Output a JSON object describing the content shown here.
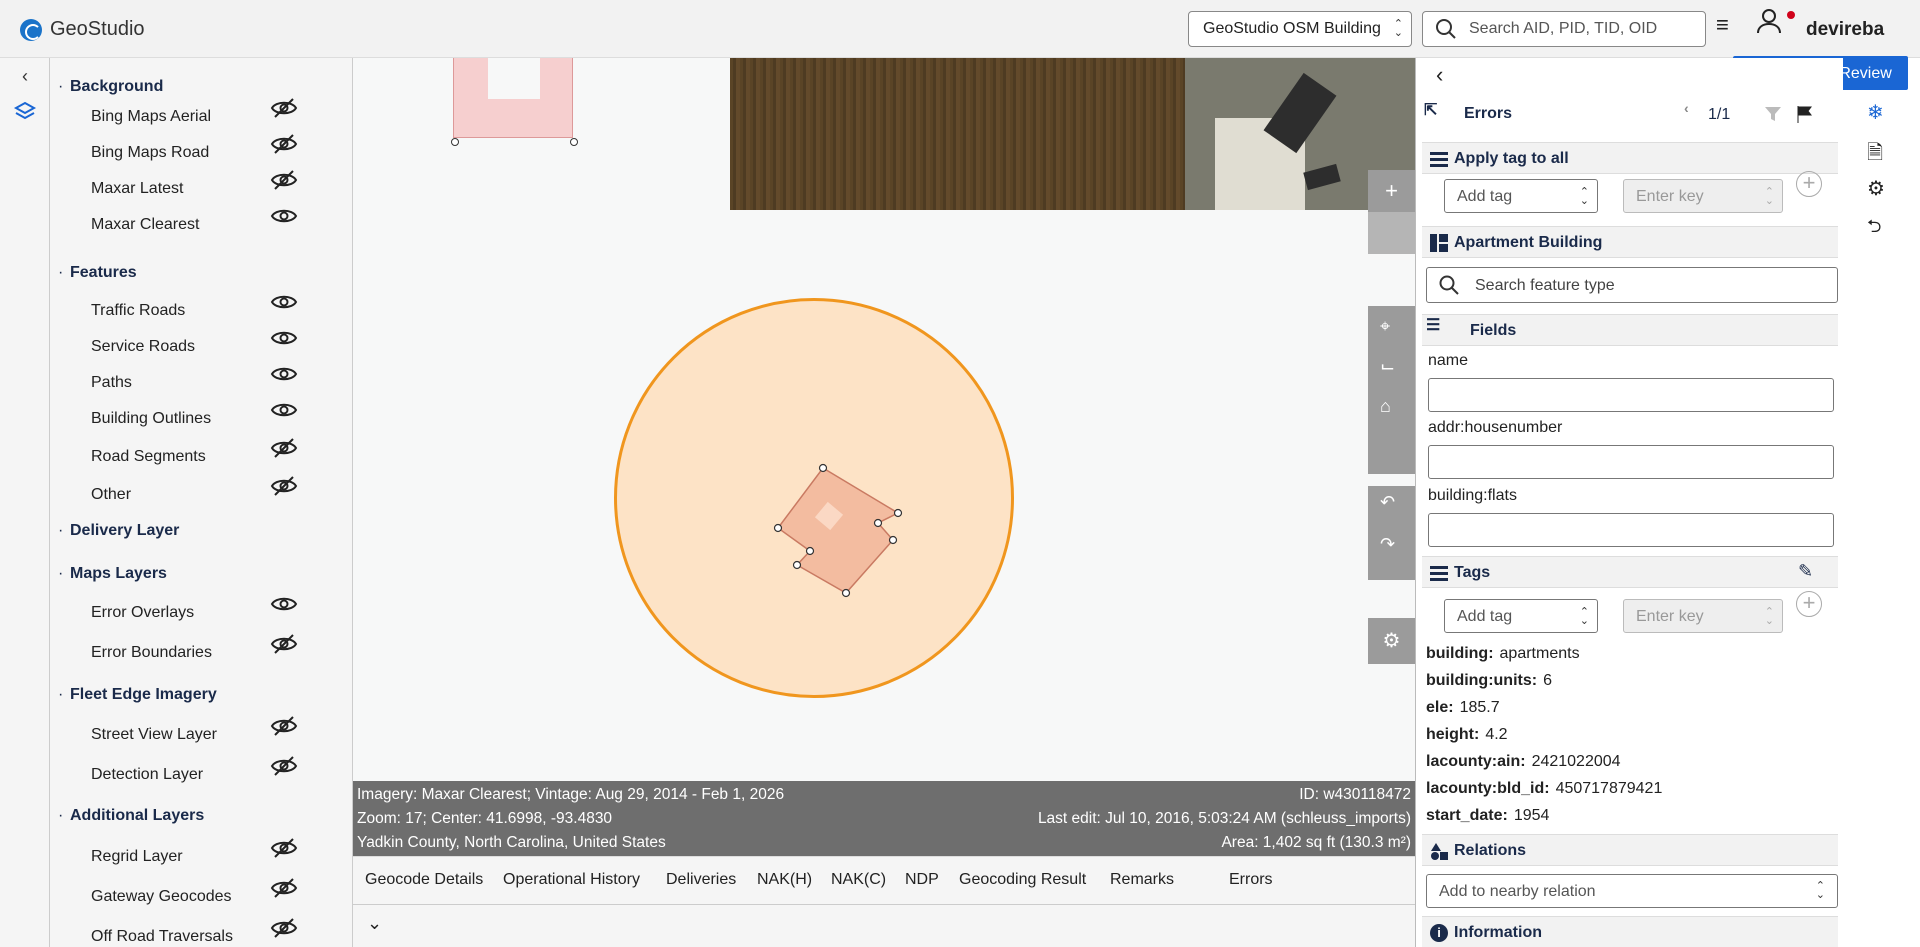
{
  "app": {
    "title": "GeoStudio"
  },
  "header": {
    "project_select": "GeoStudio OSM Building",
    "search_placeholder": "Search AID, PID, TID, OID",
    "username": "devireba"
  },
  "layers": {
    "sections": [
      {
        "name": "Background",
        "items": [
          {
            "label": "Bing Maps Aerial",
            "visible": false
          },
          {
            "label": "Bing Maps Road",
            "visible": false
          },
          {
            "label": "Maxar Latest",
            "visible": false
          },
          {
            "label": "Maxar Clearest",
            "visible": true
          }
        ]
      },
      {
        "name": "Features",
        "items": [
          {
            "label": "Traffic Roads",
            "visible": true
          },
          {
            "label": "Service Roads",
            "visible": true
          },
          {
            "label": "Paths",
            "visible": true
          },
          {
            "label": "Building Outlines",
            "visible": true
          },
          {
            "label": "Road Segments",
            "visible": false
          },
          {
            "label": "Other",
            "visible": false
          }
        ]
      },
      {
        "name": "Delivery Layer",
        "items": []
      },
      {
        "name": "Maps Layers",
        "items": [
          {
            "label": "Error Overlays",
            "visible": true
          },
          {
            "label": "Error Boundaries",
            "visible": false
          }
        ]
      },
      {
        "name": "Fleet Edge Imagery",
        "items": [
          {
            "label": "Street View Layer",
            "visible": false
          },
          {
            "label": "Detection Layer",
            "visible": false
          }
        ]
      },
      {
        "name": "Additional Layers",
        "items": [
          {
            "label": "Regrid Layer",
            "visible": false
          },
          {
            "label": "Gateway Geocodes",
            "visible": false
          },
          {
            "label": "Off Road Traversals",
            "visible": false
          }
        ]
      }
    ]
  },
  "map": {
    "controls": [
      "+"
    ],
    "info": {
      "imagery": "Imagery: Maxar Clearest; Vintage: Aug 29, 2014 - Feb 1, 2026",
      "id": "ID: w430118472",
      "zoom_center": "Zoom: 17; Center: 41.6998, -93.4830",
      "last_edit": "Last edit: Jul 10, 2016, 5:03:24 AM (schleuss_imports)",
      "location": "Yadkin County, North Carolina, United States",
      "area": "Area: 1,402 sq ft (130.3 m²)"
    },
    "bottom_tabs": [
      "Geocode Details",
      "Operational History",
      "Deliveries",
      "NAK(H)",
      "NAK(C)",
      "NDP",
      "Geocoding Result",
      "Remarks",
      "Errors"
    ]
  },
  "panel": {
    "review_button": "NDL BO/BN Review",
    "errors": {
      "title": "Errors",
      "pager": "1/1"
    },
    "apply_tag": {
      "title": "Apply tag to all",
      "add_tag": "Add tag",
      "enter_key": "Enter key"
    },
    "preset": {
      "title": "Apartment Building",
      "search_placeholder": "Search feature type"
    },
    "fields": {
      "title": "Fields",
      "items": [
        {
          "label": "name",
          "value": ""
        },
        {
          "label": "addr:housenumber",
          "value": ""
        },
        {
          "label": "building:flats",
          "value": ""
        }
      ]
    },
    "tags": {
      "title": "Tags",
      "add_tag": "Add tag",
      "enter_key": "Enter key",
      "items": [
        {
          "key": "building:",
          "value": "apartments"
        },
        {
          "key": "building:units:",
          "value": "6"
        },
        {
          "key": "ele:",
          "value": "185.7"
        },
        {
          "key": "height:",
          "value": "4.2"
        },
        {
          "key": "lacounty:ain:",
          "value": "2421022004"
        },
        {
          "key": "lacounty:bld_id:",
          "value": "450717879421"
        },
        {
          "key": "start_date:",
          "value": "1954"
        }
      ]
    },
    "relations": {
      "title": "Relations",
      "placeholder": "Add to nearby relation"
    },
    "information": {
      "title": "Information"
    }
  },
  "colors": {
    "accent": "#1a66d4",
    "circle_stroke": "#f0961e",
    "circle_fill": "#fde3c6",
    "building_fill": "#f3bca0"
  }
}
